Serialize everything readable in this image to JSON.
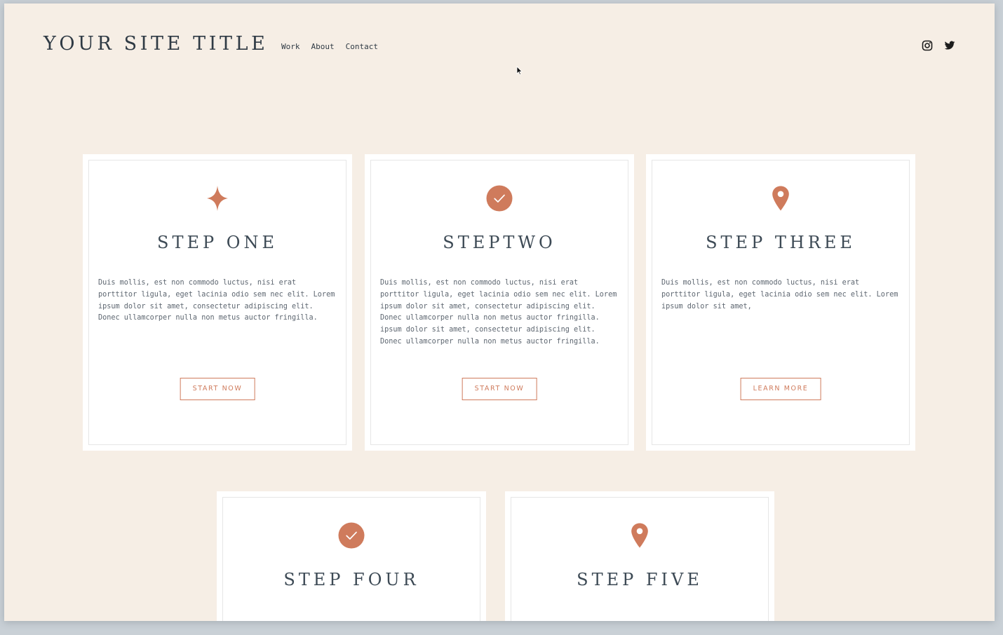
{
  "header": {
    "site_title": "YOUR SITE TITLE",
    "nav": [
      "Work",
      "About",
      "Contact"
    ],
    "social_icons": [
      "instagram-icon",
      "twitter-icon"
    ]
  },
  "colors": {
    "background": "#f6eee5",
    "card": "#ffffff",
    "accent": "#cf7b5c",
    "text": "#3d4a55"
  },
  "cards": [
    {
      "icon": "sparkle-icon",
      "title": "STEP ONE",
      "body": "Duis mollis, est non commodo luctus, nisi erat porttitor ligula, eget lacinia odio sem nec elit. Lorem ipsum dolor sit amet, consectetur adipiscing elit. Donec ullamcorper nulla non metus auctor fringilla.",
      "button": "START NOW"
    },
    {
      "icon": "check-circle-icon",
      "title": "STEPTWO",
      "body": "Duis mollis, est non commodo luctus, nisi erat porttitor ligula, eget lacinia odio sem nec elit. Lorem ipsum dolor sit amet, consectetur adipiscing elit. Donec ullamcorper nulla non metus auctor fringilla. ipsum dolor sit amet, consectetur adipiscing elit. Donec ullamcorper nulla non metus auctor fringilla.",
      "button": "START NOW"
    },
    {
      "icon": "map-pin-icon",
      "title": "STEP THREE",
      "body": "Duis mollis, est non commodo luctus, nisi erat porttitor ligula, eget lacinia odio sem nec elit. Lorem ipsum dolor sit amet,",
      "button": "LEARN MORE"
    },
    {
      "icon": "check-circle-icon",
      "title": "STEP FOUR"
    },
    {
      "icon": "map-pin-icon",
      "title": "STEP FIVE"
    }
  ]
}
